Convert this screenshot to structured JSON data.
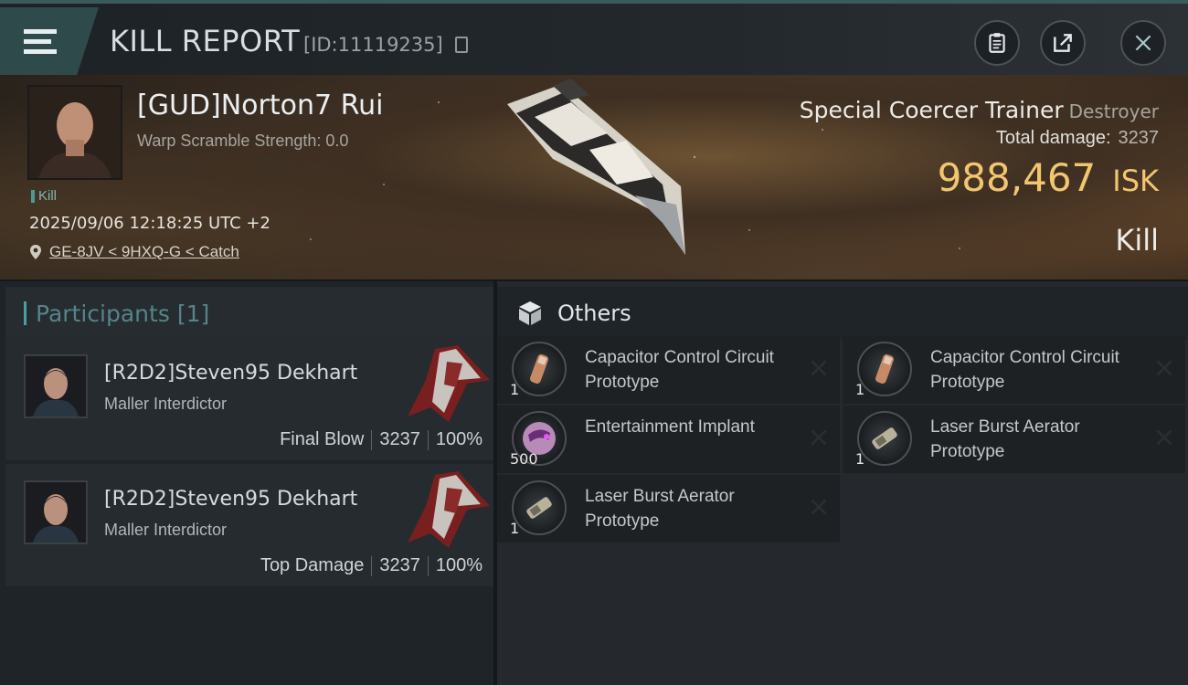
{
  "header": {
    "title": "KILL REPORT",
    "id_text": "[ID:11119235]",
    "icons": [
      "menu-icon",
      "copy-icon",
      "clipboard-icon",
      "share-icon",
      "close-icon"
    ]
  },
  "victim": {
    "name": "[GUD]Norton7 Rui",
    "warp_scramble": "Warp Scramble Strength: 0.0",
    "kill_tag": "Kill",
    "datetime": "2025/09/06 12:18:25 UTC +2",
    "location": "GE-8JV < 9HXQ-G < Catch"
  },
  "ship": {
    "name": "Special Coercer Trainer",
    "class": "Destroyer",
    "total_damage_label": "Total damage:",
    "total_damage": "3237",
    "isk_value": "988,467",
    "isk_unit": "ISK",
    "result": "Kill"
  },
  "participants": {
    "title": "Participants",
    "count": "[1]",
    "rows": [
      {
        "name": "[R2D2]Steven95 Dekhart",
        "ship": "Maller Interdictor",
        "role": "Final Blow",
        "damage": "3237",
        "percent": "100%"
      },
      {
        "name": "[R2D2]Steven95 Dekhart",
        "ship": "Maller Interdictor",
        "role": "Top Damage",
        "damage": "3237",
        "percent": "100%"
      }
    ]
  },
  "others": {
    "title": "Others",
    "items": [
      {
        "name": "Capacitor Control Circuit Prototype",
        "qty": "1",
        "icon": "capacitor-icon"
      },
      {
        "name": "Capacitor Control Circuit Prototype",
        "qty": "1",
        "icon": "capacitor-icon"
      },
      {
        "name": "Entertainment Implant",
        "qty": "500",
        "icon": "implant-icon"
      },
      {
        "name": "Laser Burst Aerator Prototype",
        "qty": "1",
        "icon": "laser-icon"
      },
      {
        "name": "Laser Burst Aerator Prototype",
        "qty": "1",
        "icon": "laser-icon"
      }
    ]
  },
  "colors": {
    "accent_teal": "#4c9fa0",
    "isk_gold": "#f2c66f"
  }
}
